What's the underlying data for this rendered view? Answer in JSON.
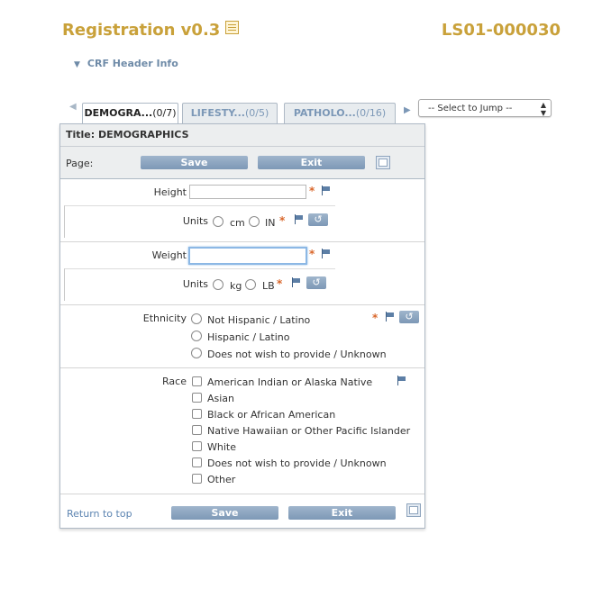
{
  "header": {
    "app_title": "Registration v0.3",
    "record_id": "LS01-000030",
    "crf_header_toggle": "CRF Header Info"
  },
  "tabs": [
    {
      "label": "DEMOGRA...",
      "count": "(0/7)",
      "active": true
    },
    {
      "label": "LIFESTY...",
      "count": "(0/5)",
      "active": false
    },
    {
      "label": "PATHOLO...",
      "count": "(0/16)",
      "active": false
    }
  ],
  "jump_select": {
    "value": "-- Select to Jump --"
  },
  "form": {
    "title": "Title: DEMOGRAPHICS",
    "page_label": "Page:",
    "save_label": "Save",
    "exit_label": "Exit",
    "height": {
      "label": "Height",
      "value": ""
    },
    "height_units": {
      "label": "Units",
      "options": [
        "cm",
        "IN"
      ]
    },
    "weight": {
      "label": "Weight",
      "value": ""
    },
    "weight_units": {
      "label": "Units",
      "options": [
        "kg",
        "LB"
      ]
    },
    "ethnicity": {
      "label": "Ethnicity",
      "options": [
        "Not Hispanic / Latino",
        "Hispanic / Latino",
        "Does not wish to provide / Unknown"
      ]
    },
    "race": {
      "label": "Race",
      "options": [
        "American Indian or Alaska Native",
        "Asian",
        "Black or African American",
        "Native Hawaiian or Other Pacific Islander",
        "White",
        "Does not wish to provide / Unknown",
        "Other"
      ]
    },
    "required_mark": "*",
    "reset_glyph": "↺",
    "return_to_top": "Return to top"
  },
  "colors": {
    "brand_gold": "#c9a13a",
    "accent_blue": "#7d98b6",
    "required_orange": "#d9662a"
  }
}
